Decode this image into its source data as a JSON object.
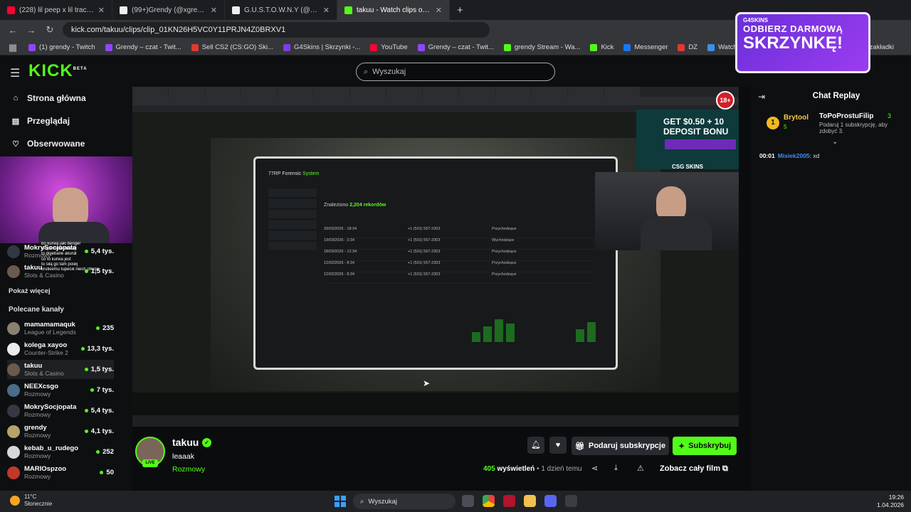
{
  "browser": {
    "tabs": [
      {
        "title": "(228) lil peep x lil tracy - witchb",
        "color": "#ff0033"
      },
      {
        "title": "(99+)Grendy (@xgrendy) | TikT",
        "color": "#111111"
      },
      {
        "title": "G.U.S.T.O.W.N.Y (@bohdan.vas",
        "color": "#111111"
      },
      {
        "title": "takuu - Watch clips on Kick",
        "color": "#53fc18"
      }
    ],
    "url": "kick.com/takuu/clips/clip_01KN26H5VC0Y11PRJN4Z0BRXV1",
    "bookmarks": [
      {
        "label": "(1) grendy - Twitch",
        "color": "#9146ff"
      },
      {
        "label": "Grendy – czat - Twit...",
        "color": "#9146ff"
      },
      {
        "label": "Sell CS2 (CS:GO) Ski...",
        "color": "#e03a2f"
      },
      {
        "label": "G4Skins | Skrzynki -...",
        "color": "#7b3fe4"
      },
      {
        "label": "YouTube",
        "color": "#ff0033"
      },
      {
        "label": "Grendy – czat - Twit...",
        "color": "#9146ff"
      },
      {
        "label": "grendy Stream - Wa...",
        "color": "#53fc18"
      },
      {
        "label": "Kick",
        "color": "#53fc18"
      },
      {
        "label": "Messenger",
        "color": "#1877f2"
      },
      {
        "label": "DZ",
        "color": "#e03a2f"
      },
      {
        "label": "Watch XD | Streama...",
        "color": "#3c8ef0"
      }
    ],
    "bookmarks_right": "zakładki"
  },
  "promo": {
    "brand": "G4SKINS",
    "line1": "ODBIERZ DARMOWĄ",
    "line2": "SKRZYNKĘ!"
  },
  "header": {
    "logo": "KICK",
    "logo_sup": "BETA",
    "search_placeholder": "Wyszukaj"
  },
  "sidebar": {
    "nav": [
      {
        "label": "Strona główna",
        "icon": "home-icon",
        "glyph": "⌂"
      },
      {
        "label": "Przeglądaj",
        "icon": "browse-icon",
        "glyph": "▤"
      },
      {
        "label": "Obserwowane",
        "icon": "heart-icon",
        "glyph": "♡"
      }
    ],
    "show_more": "Pokaż więcej",
    "recommended_heading": "Polecane kanały",
    "followed": [
      {
        "name": "MokrySocjopata",
        "category": "Rozmowy",
        "viewers": "5,4 tys.",
        "color": "#333844"
      },
      {
        "name": "takuu",
        "category": "Slots & Casino",
        "viewers": "1,5 tys.",
        "color": "#6b5a4e"
      }
    ],
    "channels": [
      {
        "name": "mamamamaquk",
        "category": "League of Legends",
        "viewers": "235",
        "color": "#8a7f70"
      },
      {
        "name": "kolega xayoo",
        "category": "Counter-Strike 2",
        "viewers": "13,3 tys.",
        "color": "#ececec"
      },
      {
        "name": "takuu",
        "category": "Slots & Casino",
        "viewers": "1,5 tys.",
        "color": "#6b5a4e",
        "active": true
      },
      {
        "name": "NEEXcsgo",
        "category": "Rozmowy",
        "viewers": "7 tys.",
        "color": "#4b6c8a"
      },
      {
        "name": "MokrySocjopata",
        "category": "Rozmowy",
        "viewers": "5,4 tys.",
        "color": "#333844"
      },
      {
        "name": "grendy",
        "category": "Rozmowy",
        "viewers": "4,1 tys.",
        "color": "#b8a36a"
      },
      {
        "name": "kebab_u_rudego",
        "category": "Rozmowy",
        "viewers": "252",
        "color": "#d8d8d8"
      },
      {
        "name": "MARIOspzoo",
        "category": "Rozmowy",
        "viewers": "50",
        "color": "#c0392b"
      }
    ],
    "overlay_chat": [
      "bo kurwa jaki benger",
      "kropli krutki chetoy",
      "to dojebane akurat",
      "co to kurwa jest",
      "to siłą go tam posłij",
      "krutkiemu tupecik niech ofryga"
    ]
  },
  "player": {
    "age_badge": "18+",
    "ad_text": "GET $0.50 + 10 DEPOSIT BONU",
    "ad_brand": "CSG SKINS",
    "tablet_title": "77RP Forensic",
    "tablet_title_accent": "System",
    "records_label": "Znaleziono",
    "records_count": "2,204 rekordów",
    "rows": [
      {
        "date": "29/03/2026 - 18:34",
        "number": "+1 (501) 557-2303",
        "type": "Przychodzące"
      },
      {
        "date": "19/03/2026 - 3:34",
        "number": "+1 (501) 557-2303",
        "type": "Wychodzące"
      },
      {
        "date": "18/03/2026 - 12:34",
        "number": "+1 (501) 557-2303",
        "type": "Przychodzące"
      },
      {
        "date": "12/02/2026 - 8:34",
        "number": "+1 (501) 557-2303",
        "type": "Przychodzące"
      },
      {
        "date": "12/02/2026 - 8:34",
        "number": "+1 (501) 557-2303",
        "type": "Przychodzące"
      }
    ]
  },
  "chat": {
    "title": "Chat Replay",
    "pinned": {
      "gifter": "Brytool",
      "gifter_count": "5",
      "target": "ToPoProstuFilip",
      "target_count": "3",
      "text": "Podaruj 1 subskrypcję, aby zdobyć 3."
    },
    "messages": [
      {
        "time": "00:01",
        "user": "Misiek2005",
        "text": ": xd"
      }
    ]
  },
  "clip": {
    "channel": "takuu",
    "live_badge": "LIVE",
    "title": "leaaak",
    "category": "Rozmowy",
    "gift_label": "Podaruj subskrypcje",
    "subscribe_label": "Subskrybuj",
    "views_count": "405",
    "views_label": "wyświetleń",
    "age": "• 1 dzień temu",
    "full_video_label": "Zobacz cały film"
  },
  "taskbar": {
    "temp": "11°C",
    "weather": "Słonecznie",
    "search_placeholder": "Wyszukaj",
    "time": "19:26",
    "date": "1.04.2026"
  }
}
